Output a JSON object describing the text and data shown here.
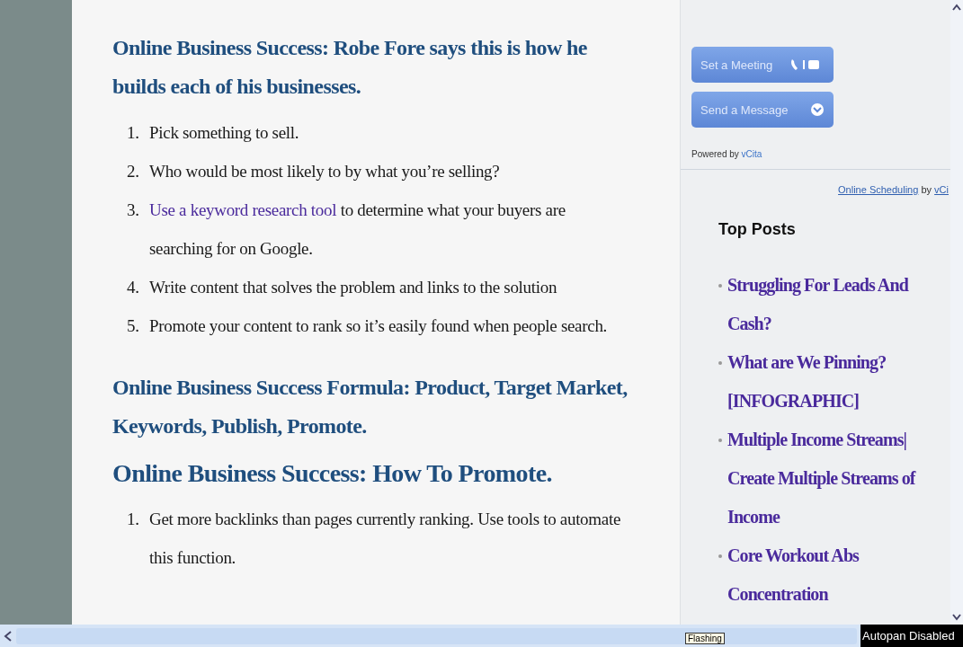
{
  "article": [
    {
      "kind": "heading",
      "text": "Online Business Success: Robe Fore says this is how he builds each of his businesses."
    },
    {
      "kind": "list",
      "items": [
        {
          "number": "1.",
          "text": "Pick something to sell."
        },
        {
          "number": "2.",
          "text": "Who would be most likely to by what you’re selling?"
        },
        {
          "number": "3.",
          "link": "Use a keyword research tool",
          "text": " to determine what your buyers are searching for on Google."
        },
        {
          "number": "4.",
          "text": "Write content that solves the problem and links to the solution"
        },
        {
          "number": "5.",
          "text": "Promote your content to rank so it’s easily found when people search."
        }
      ]
    },
    {
      "kind": "heading",
      "text": "Online Business Success Formula:  Product, Target Market, Keywords, Publish, Promote."
    },
    {
      "kind": "title",
      "text": "Online Business Success: How To Promote."
    },
    {
      "kind": "list",
      "items": [
        {
          "number": "1.",
          "text": "Get more backlinks than pages currently ranking. Use tools to automate this function."
        }
      ]
    }
  ],
  "sidebar": {
    "widget": {
      "buttons": [
        {
          "label": "Set a Meeting",
          "kind": "call"
        },
        {
          "label": "Send a Message",
          "kind": "message"
        }
      ],
      "powered_by": "Powered by",
      "powered_link": "vCita"
    },
    "scheduling_link": "Online Scheduling",
    "scheduling_by": "by",
    "scheduling_brand": "vCi",
    "top_posts": {
      "title": "Top Posts",
      "items": [
        "Struggling For Leads And Cash?",
        "What are We Pinning? [INFOGRAPHIC]",
        "Multiple Income Streams| Create Multiple Streams of Income",
        "Core Workout Abs Concentration"
      ]
    }
  },
  "status": {
    "tooltip": "Flashing",
    "badge": "Autopan Disabled"
  }
}
